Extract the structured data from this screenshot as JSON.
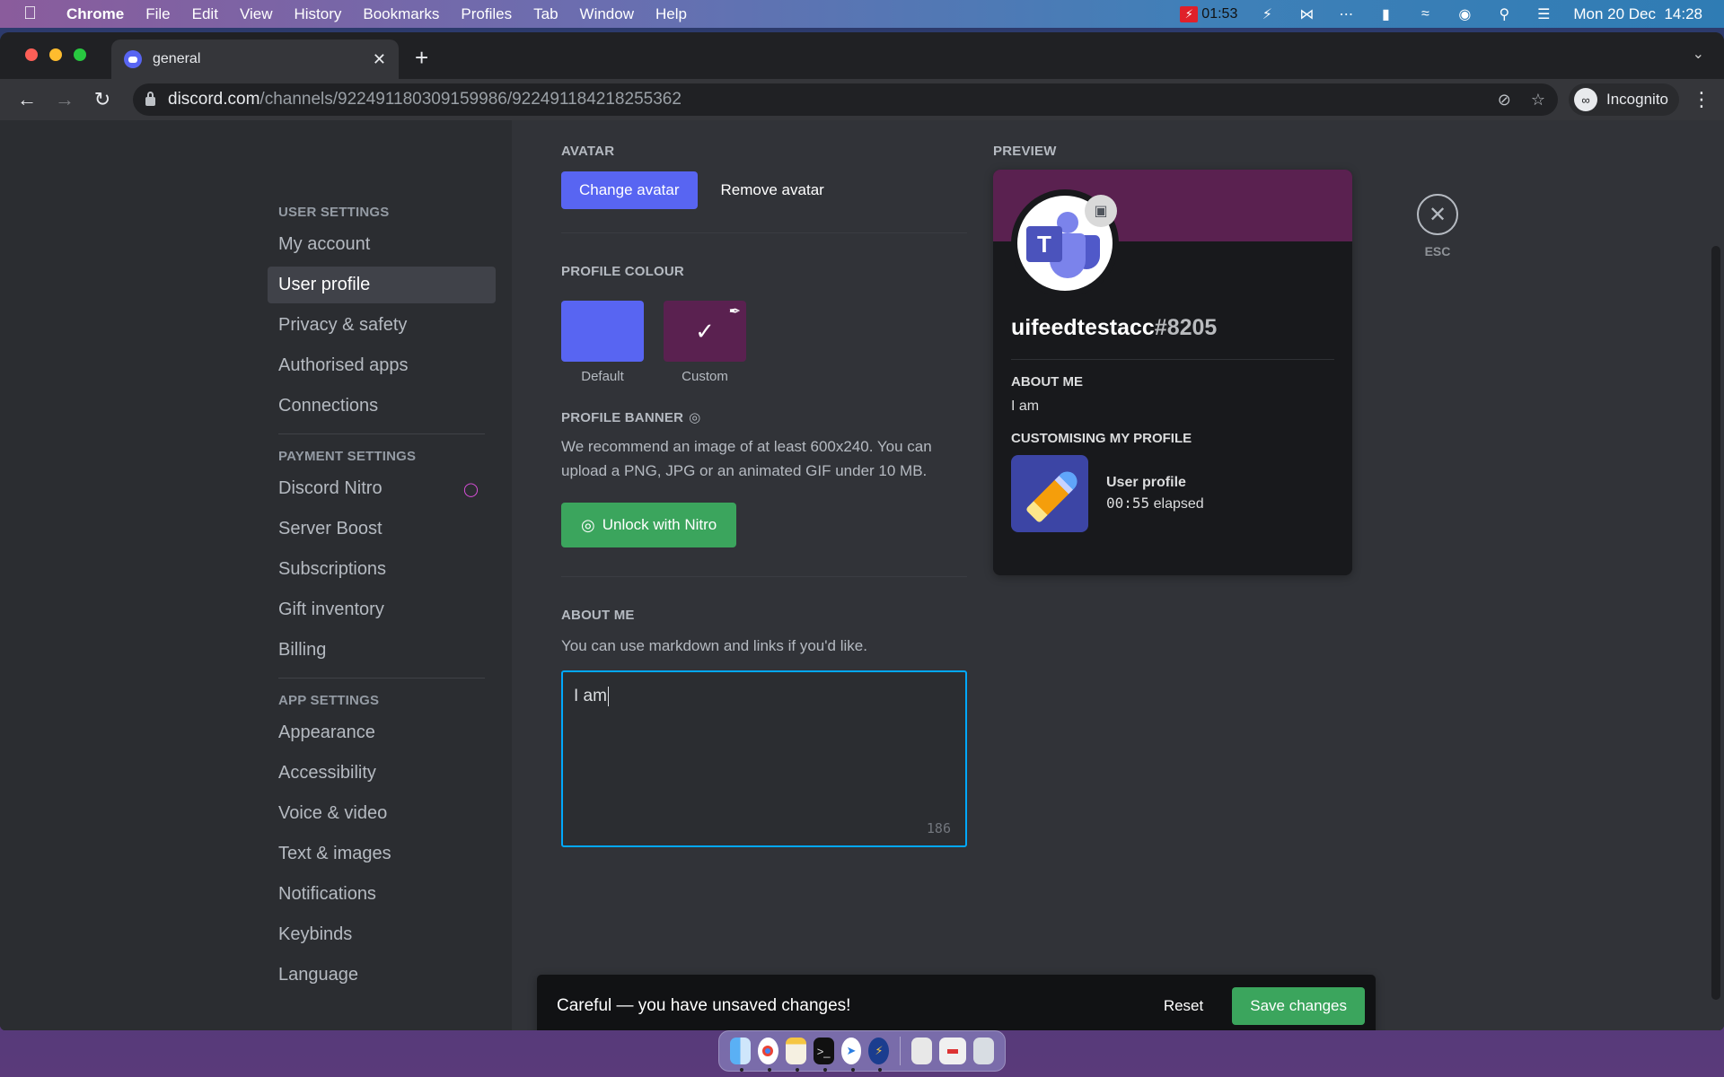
{
  "menubar": {
    "apple_icon": "apple-logo-icon",
    "app_name": "Chrome",
    "items": [
      "File",
      "Edit",
      "View",
      "History",
      "Bookmarks",
      "Profiles",
      "Tab",
      "Window",
      "Help"
    ],
    "recording_time": "01:53",
    "datetime": "Mon 20 Dec  14:28",
    "status_icons": [
      "flash-icon",
      "bluetooth-off-icon",
      "dots-icon",
      "battery-charging-icon",
      "wifi-icon",
      "user-circle-icon",
      "search-icon",
      "control-center-icon"
    ]
  },
  "browser": {
    "tab_title": "general",
    "url_host": "discord.com",
    "url_path": "/channels/922491180309159986/922491184218255362",
    "profile_label": "Incognito"
  },
  "sidebar": {
    "sections": [
      {
        "header": "USER SETTINGS",
        "items": [
          {
            "label": "My account",
            "active": false
          },
          {
            "label": "User profile",
            "active": true
          },
          {
            "label": "Privacy & safety",
            "active": false
          },
          {
            "label": "Authorised apps",
            "active": false
          },
          {
            "label": "Connections",
            "active": false
          }
        ]
      },
      {
        "header": "PAYMENT SETTINGS",
        "items": [
          {
            "label": "Discord Nitro",
            "active": false,
            "badge": "nitro-icon"
          },
          {
            "label": "Server Boost",
            "active": false
          },
          {
            "label": "Subscriptions",
            "active": false
          },
          {
            "label": "Gift inventory",
            "active": false
          },
          {
            "label": "Billing",
            "active": false
          }
        ]
      },
      {
        "header": "APP SETTINGS",
        "items": [
          {
            "label": "Appearance",
            "active": false
          },
          {
            "label": "Accessibility",
            "active": false
          },
          {
            "label": "Voice & video",
            "active": false
          },
          {
            "label": "Text & images",
            "active": false
          },
          {
            "label": "Notifications",
            "active": false
          },
          {
            "label": "Keybinds",
            "active": false
          },
          {
            "label": "Language",
            "active": false
          }
        ]
      }
    ]
  },
  "profile": {
    "avatar_title": "AVATAR",
    "change_avatar": "Change avatar",
    "remove_avatar": "Remove avatar",
    "colour_title": "PROFILE COLOUR",
    "colour_default_label": "Default",
    "colour_custom_label": "Custom",
    "colour_default_hex": "#5865f2",
    "colour_custom_hex": "#5a2150",
    "selected_colour": "Custom",
    "banner_title": "PROFILE BANNER",
    "banner_desc": "We recommend an image of at least 600x240. You can upload a PNG, JPG or an animated GIF under 10 MB.",
    "unlock_nitro": "Unlock with Nitro",
    "about_title": "ABOUT ME",
    "about_desc": "You can use markdown and links if you'd like.",
    "about_value": "I am",
    "char_remaining": "186"
  },
  "preview": {
    "title": "PREVIEW",
    "username": "uifeedtestacc",
    "discriminator": "#8205",
    "about_header": "ABOUT ME",
    "about_text": "I am",
    "activity_header": "CUSTOMISING MY PROFILE",
    "activity_title": "User profile",
    "activity_time": "00:55",
    "activity_suffix": " elapsed"
  },
  "close": {
    "icon": "close-icon",
    "label": "ESC"
  },
  "notice": {
    "text": "Careful — you have unsaved changes!",
    "reset": "Reset",
    "save": "Save changes"
  },
  "dock": {
    "apps": [
      "Finder",
      "Chrome",
      "Notes",
      "Terminal",
      "Safari",
      "Reeder",
      "Preview",
      "Screenshot",
      "Trash"
    ]
  }
}
